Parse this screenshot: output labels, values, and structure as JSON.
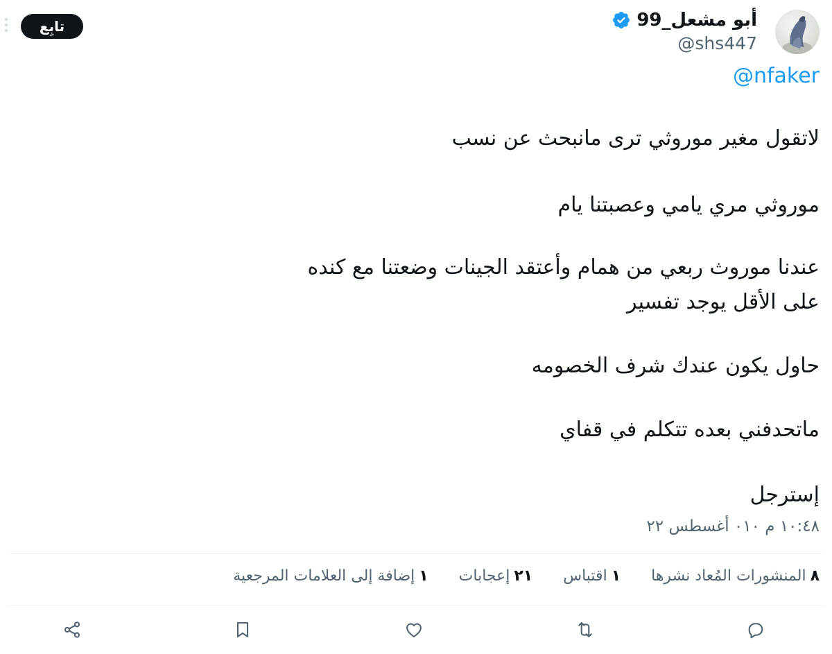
{
  "header": {
    "display_name": "أبو مشعل_99",
    "handle": "@shs447",
    "follow_label": "تابِع",
    "verified_color": "#1d9bf0"
  },
  "tweet": {
    "mention": "@nfaker",
    "lines": [
      "لاتقول مغير موروثي ترى مانبحث عن نسب",
      "موروثي مري يامي وعصبتنا يام",
      "عندنا موروث ربعي من همام وأعتقد الجينات وضعتنا مع كنده",
      "على الأقل يوجد تفسير",
      "حاول يكون عندك شرف الخصومه",
      "ماتحدفني بعده تتكلم في قفاي",
      "إسترجل"
    ],
    "timestamp": "١٠:٤٨ م ٠١٠ أغسطس ٢٢"
  },
  "stats": {
    "reposts": {
      "count": "٨",
      "label": "المنشورات المُعاد نشرها"
    },
    "quotes": {
      "count": "١",
      "label": "اقتباس"
    },
    "likes": {
      "count": "٢١",
      "label": "إعجابات"
    },
    "bookmarks": {
      "count": "١",
      "label": "إضافة إلى العلامات المرجعية"
    }
  },
  "actions": [
    "reply-icon",
    "repost-icon",
    "like-icon",
    "bookmark-icon",
    "share-icon"
  ],
  "colors": {
    "accent": "#1d9bf0",
    "text": "#0f1419",
    "secondary": "#536471",
    "divider": "#eff3f4"
  }
}
